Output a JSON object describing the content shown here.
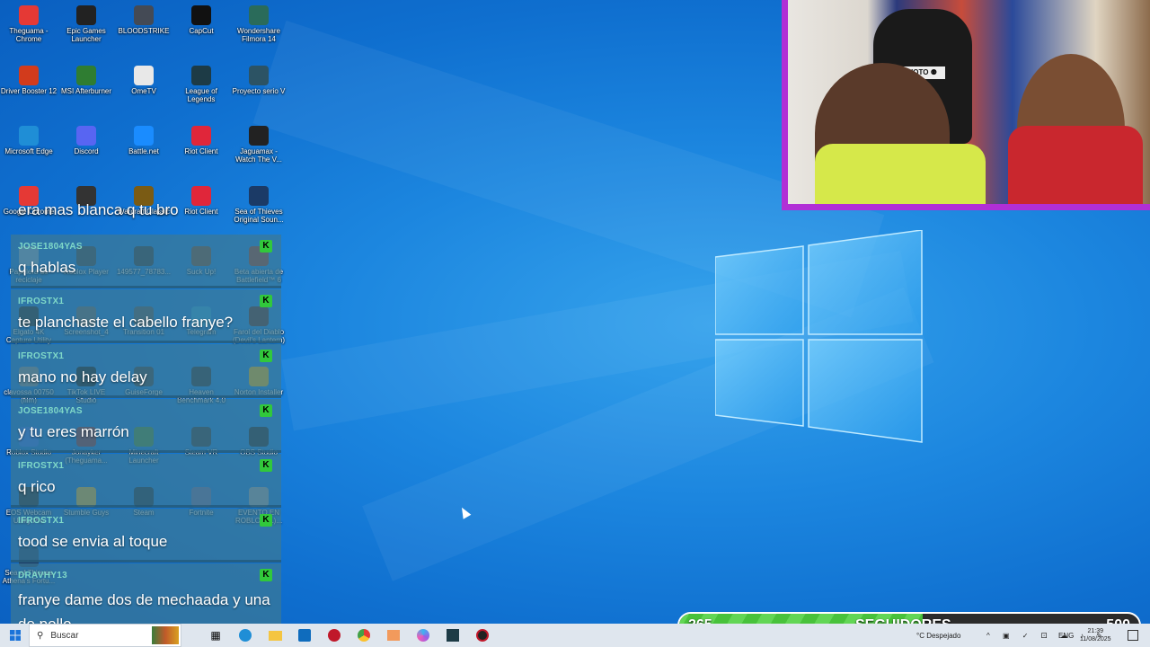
{
  "desktop_icons": [
    {
      "label": "Theguama - Chrome",
      "icon": "chrome-icon",
      "color": "#e53935"
    },
    {
      "label": "Epic Games Launcher",
      "icon": "epic-games-icon",
      "color": "#222222"
    },
    {
      "label": "BLOODSTRIKE",
      "icon": "bloodstrike-icon",
      "color": "#444a55"
    },
    {
      "label": "CapCut",
      "icon": "capcut-icon",
      "color": "#111111"
    },
    {
      "label": "Wondershare Filmora 14",
      "icon": "filmora-icon",
      "color": "#2a6b5a"
    },
    {
      "label": "Driver Booster 12",
      "icon": "driver-booster-icon",
      "color": "#d23b1c"
    },
    {
      "label": "MSI Afterburner",
      "icon": "msi-afterburner-icon",
      "color": "#2f7d32"
    },
    {
      "label": "OmeTV",
      "icon": "ometv-icon",
      "color": "#e8e8e8"
    },
    {
      "label": "League of Legends",
      "icon": "league-of-legends-icon",
      "color": "#1d3b46"
    },
    {
      "label": "Proyecto serio V",
      "icon": "proyecto-icon",
      "color": "#2c5364"
    },
    {
      "label": "Microsoft Edge",
      "icon": "edge-icon",
      "color": "#1f8ed6"
    },
    {
      "label": "Discord",
      "icon": "discord-icon",
      "color": "#5865f2"
    },
    {
      "label": "Battle.net",
      "icon": "battlenet-icon",
      "color": "#1a8cff"
    },
    {
      "label": "Riot Client",
      "icon": "riot-client-icon",
      "color": "#e0263a"
    },
    {
      "label": "Jaguamax - Watch The V...",
      "icon": "video-icon",
      "color": "#222222"
    },
    {
      "label": "Google Chrome",
      "icon": "chrome-icon",
      "color": "#e53935"
    },
    {
      "label": "",
      "icon": "blank-icon",
      "color": "#333333"
    },
    {
      "label": "Warcraft Classic",
      "icon": "warcraft-icon",
      "color": "#7a5b14"
    },
    {
      "label": "Riot Client",
      "icon": "riot-client-icon",
      "color": "#e0263a"
    },
    {
      "label": "Sea of Thieves Original Soun...",
      "icon": "music-icon",
      "color": "#1b3a66"
    },
    {
      "label": "Papelera de reciclaje",
      "icon": "recycle-bin-icon",
      "color": "#8aa4c0"
    },
    {
      "label": "Roblox Player",
      "icon": "roblox-icon",
      "color": "#3d3d3d"
    },
    {
      "label": "149577_78783...",
      "icon": "image-icon",
      "color": "#333333"
    },
    {
      "label": "Suck Up!",
      "icon": "suck-up-icon",
      "color": "#7a4a2a"
    },
    {
      "label": "Beta abierta de Battlefield™ 6",
      "icon": "battlefield-icon",
      "color": "#a33b1c"
    },
    {
      "label": "Elgato 4K Capture Utility",
      "icon": "elgato-icon",
      "color": "#222222"
    },
    {
      "label": "Screenshot_4",
      "icon": "image-icon",
      "color": "#666666"
    },
    {
      "label": "Transition 01",
      "icon": "video-icon",
      "color": "#555555"
    },
    {
      "label": "Telegram",
      "icon": "telegram-icon",
      "color": "#2aa3de"
    },
    {
      "label": "Farol del Diablo (Devil's Lantern)",
      "icon": "lantern-icon",
      "color": "#5b2a1a"
    },
    {
      "label": "clavossa 00750 (film)",
      "icon": "file-icon",
      "color": "#888888"
    },
    {
      "label": "TikTok LIVE Studio",
      "icon": "tiktok-icon",
      "color": "#111111"
    },
    {
      "label": "GuiseForge",
      "icon": "guiseforge-icon",
      "color": "#3a3a3a"
    },
    {
      "label": "Heaven Benchmark 4.0",
      "icon": "heaven-icon",
      "color": "#2e2e2e"
    },
    {
      "label": "Norton Installer",
      "icon": "norton-icon",
      "color": "#f2b705"
    },
    {
      "label": "Roblox Studio",
      "icon": "roblox-studio-icon",
      "color": "#2c6ee8"
    },
    {
      "label": "Jonayker (Theguama...",
      "icon": "file-icon",
      "color": "#8b2a2a"
    },
    {
      "label": "Minecraft Launcher",
      "icon": "minecraft-icon",
      "color": "#4d8a2e"
    },
    {
      "label": "Steam VR",
      "icon": "steamvr-icon",
      "color": "#333333"
    },
    {
      "label": "OBS Studio",
      "icon": "obs-icon",
      "color": "#222222"
    },
    {
      "label": "EOS Webcam Utility Pro",
      "icon": "webcam-icon",
      "color": "#222222"
    },
    {
      "label": "Stumble Guys",
      "icon": "stumble-guys-icon",
      "color": "#e8b020"
    },
    {
      "label": "Steam",
      "icon": "steam-icon",
      "color": "#1b2838"
    },
    {
      "label": "Fortnite",
      "icon": "fortnite-icon",
      "color": "#6d6d9a"
    },
    {
      "label": "EVENTO EN ROBLOX (1)...",
      "icon": "file-icon",
      "color": "#a0a0a0"
    },
    {
      "label": "Sea of Thieves Athena's Fortu...",
      "icon": "music-icon",
      "color": "#1b3a66"
    }
  ],
  "chat": {
    "top_partial": "era mas blanca q tu bro",
    "messages": [
      {
        "user": "JOSE1804YAS",
        "text": "q hablas",
        "badge": "K"
      },
      {
        "user": "IFROSTX1",
        "text": "te planchaste el cabello franye?",
        "badge": "K"
      },
      {
        "user": "IFROSTX1",
        "text": "mano no hay delay",
        "badge": "K"
      },
      {
        "user": "JOSE1804YAS",
        "text": "y tu eres marrón",
        "badge": "K"
      },
      {
        "user": "IFROSTX1",
        "text": "q rico",
        "badge": "K"
      },
      {
        "user": "IFROSTX1",
        "text": "tood se envia al toque",
        "badge": "K"
      },
      {
        "user": "DRAVHY13",
        "text": "franye dame dos de mechaada y una de pollo",
        "badge": "K"
      }
    ]
  },
  "follower_goal": {
    "current": "265",
    "label": "SEGUIDORES",
    "target": "500",
    "progress": 0.53,
    "color_fill": "#48c23b"
  },
  "taskbar": {
    "search_placeholder": "Buscar",
    "weather": "°C Despejado",
    "language": "ENG",
    "time": "21:39",
    "date": "11/08/2025"
  },
  "colors": {
    "desktop": "#1c86df",
    "webcam_border": "#b12fd6"
  }
}
